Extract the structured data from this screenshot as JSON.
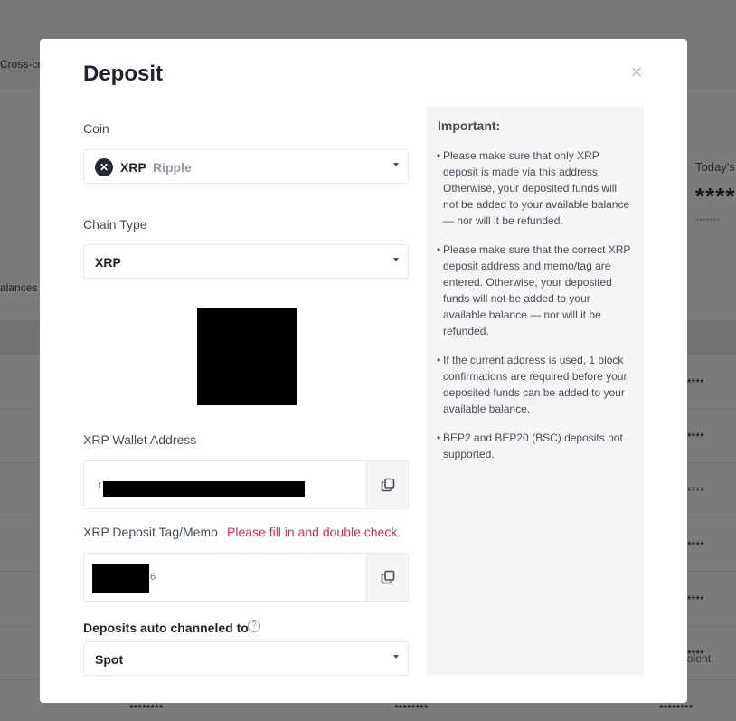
{
  "background": {
    "cross_tab": "Cross-co",
    "balances_label": "alances",
    "today_label": "Today's",
    "today_value": "****",
    "today_sub": "*******",
    "equiv_header": "alent",
    "row_values": [
      "****",
      "****",
      "****",
      "****",
      "****",
      "****"
    ],
    "bottom_values": [
      "********",
      "********",
      "********"
    ]
  },
  "modal": {
    "title": "Deposit",
    "close_icon": "×",
    "coin": {
      "label": "Coin",
      "icon": "✕",
      "symbol": "XRP",
      "name": "Ripple"
    },
    "chain": {
      "label": "Chain Type",
      "value": "XRP"
    },
    "address": {
      "label": "XRP Wallet Address",
      "visible_prefix": "r"
    },
    "memo": {
      "label": "XRP Deposit Tag/Memo",
      "warning": "Please fill in and double check.",
      "visible_suffix": "6"
    },
    "auto_channel": {
      "label": "Deposits auto channeled to",
      "help_icon": "?",
      "value": "Spot"
    },
    "important": {
      "title": "Important:",
      "notes": [
        "Please make sure that only XRP deposit is made via this address. Otherwise, your deposited funds will not be added to your available balance — nor will it be refunded.",
        "Please make sure that the correct XRP deposit address and memo/tag are entered. Otherwise, your deposited funds will not be added to your available balance — nor will it be refunded.",
        "If the current address is used, 1 block confirmations are required before your deposited funds can be added to your available balance.",
        "BEP2 and BEP20 (BSC) deposits not supported."
      ]
    }
  },
  "colors": {
    "warning": "#cf304a",
    "text_primary": "#1e2329",
    "text_secondary": "#474d57",
    "muted": "#929aa5"
  }
}
